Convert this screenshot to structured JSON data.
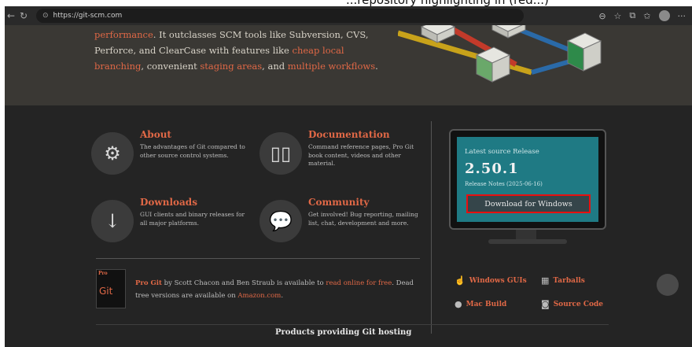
{
  "top_strip": {
    "text": "...repository highlighting in (red...)"
  },
  "browser": {
    "url": "https://git-scm.com",
    "back_icon": "back-arrow-icon",
    "reload_icon": "reload-icon",
    "more_label": "···"
  },
  "hero": {
    "text_part1": "performance",
    "text_part2": ". It outclasses SCM tools like Subversion, CVS, Perforce, and ClearCase with features like ",
    "text_link1": "cheap local branching",
    "text_part3": ", convenient ",
    "text_link2": "staging areas",
    "text_part4": ", and ",
    "text_link3": "multiple workflows",
    "text_part5": "."
  },
  "features": [
    {
      "title": "About",
      "desc": "The advantages of Git compared to other source control systems.",
      "icon": "gears-icon"
    },
    {
      "title": "Documentation",
      "desc": "Command reference pages, Pro Git book content, videos and other material.",
      "icon": "book-icon"
    },
    {
      "title": "Downloads",
      "desc": "GUI clients and binary releases for all major platforms.",
      "icon": "download-arrow-icon"
    },
    {
      "title": "Community",
      "desc": "Get involved! Bug reporting, mailing list, chat, development and more.",
      "icon": "chat-bubbles-icon"
    }
  ],
  "progit": {
    "book_label": "Pro",
    "book_title": "Git",
    "title": "Pro Git",
    "text1": " by Scott Chacon and Ben Straub is available to ",
    "link": "read online for free",
    "text2": ". Dead tree versions are available on ",
    "amazon": "Amazon.com",
    "text3": "."
  },
  "release": {
    "label": "Latest source Release",
    "version": "2.50.1",
    "date_label": "Release Notes (2025-06-16)",
    "download_button": "Download for Windows"
  },
  "downloads": {
    "windows_guis": "Windows GUIs",
    "tarballs": "Tarballs",
    "mac_build": "Mac Build",
    "source_code": "Source Code"
  },
  "footer": {
    "products": "Products providing Git hosting"
  },
  "colors": {
    "accent": "#e06846",
    "highlight_border": "#e81010",
    "screen": "#1f7a84"
  }
}
